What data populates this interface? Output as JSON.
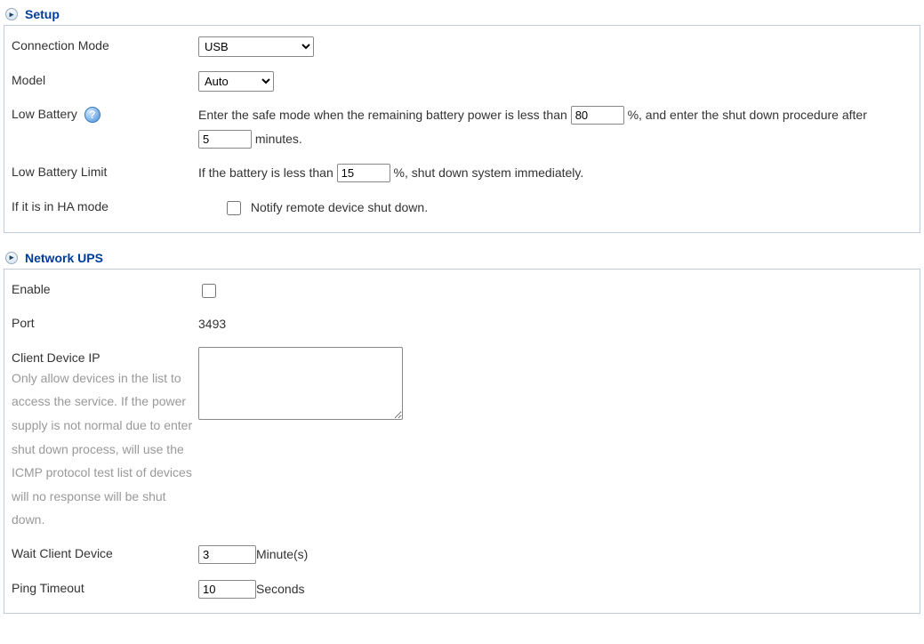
{
  "setup": {
    "title": "Setup",
    "connection_mode_label": "Connection Mode",
    "connection_mode_value": "USB",
    "model_label": "Model",
    "model_value": "Auto",
    "low_battery_label": "Low Battery",
    "low_battery_text_1": "Enter the safe mode when the remaining battery power is less than ",
    "low_battery_percent": "80",
    "low_battery_text_2": " %, and enter the shut down procedure after ",
    "low_battery_minutes": "5",
    "low_battery_text_3": " minutes.",
    "low_battery_limit_label": "Low Battery Limit",
    "low_battery_limit_text_1": "If the battery is less than ",
    "low_battery_limit_value": "15",
    "low_battery_limit_text_2": " %, shut down system immediately.",
    "ha_mode_label": "If it is in HA mode",
    "ha_mode_checkbox_label": "Notify remote device shut down."
  },
  "network_ups": {
    "title": "Network UPS",
    "enable_label": "Enable",
    "port_label": "Port",
    "port_value": "3493",
    "client_ip_label": "Client Device IP",
    "client_ip_hint": "Only allow devices in the list to access the service. If the power supply is not normal due to enter shut down process, will use the ICMP protocol test list of devices will no response will be shut down.",
    "client_ip_value": "",
    "wait_client_label": "Wait Client Device",
    "wait_client_value": "3",
    "wait_client_unit": "Minute(s)",
    "ping_timeout_label": "Ping Timeout",
    "ping_timeout_value": "10",
    "ping_timeout_unit": "Seconds"
  }
}
